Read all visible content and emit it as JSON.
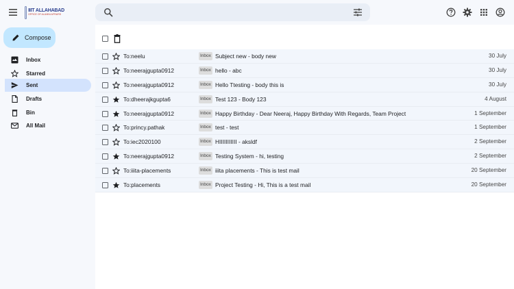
{
  "header": {
    "logo_title": "IIIT ALLAHABAD",
    "logo_subtitle": "OFFICE OF ALUMNI AFFAIRS",
    "search_placeholder": "",
    "search_value": ""
  },
  "sidebar": {
    "compose_label": "Compose",
    "items": [
      {
        "label": "Inbox",
        "icon": "inbox-icon",
        "active": false
      },
      {
        "label": "Starred",
        "icon": "star-icon",
        "active": false
      },
      {
        "label": "Sent",
        "icon": "send-icon",
        "active": true
      },
      {
        "label": "Drafts",
        "icon": "draft-icon",
        "active": false
      },
      {
        "label": "Bin",
        "icon": "bin-icon",
        "active": false
      },
      {
        "label": "All Mail",
        "icon": "mail-icon",
        "active": false
      }
    ]
  },
  "mails": [
    {
      "to": "To:neelu",
      "badge": "Inbox",
      "subject": "Subject new - body new",
      "date": "30 July",
      "starred": false
    },
    {
      "to": "To:neerajgupta0912",
      "badge": "Inbox",
      "subject": "hello - abc",
      "date": "30 July",
      "starred": false
    },
    {
      "to": "To:neerajgupta0912",
      "badge": "Inbox",
      "subject": "Hello Ttesting - body this is",
      "date": "30 July",
      "starred": false
    },
    {
      "to": "To:dheerajkgupta6",
      "badge": "Inbox",
      "subject": "Test 123 - Body 123",
      "date": "4 August",
      "starred": true
    },
    {
      "to": "To:neerajgupta0912",
      "badge": "Inbox",
      "subject": "Happy Birthday - Dear Neeraj, Happy Birthday With Regards, Team Project",
      "date": "1 September",
      "starred": true
    },
    {
      "to": "To:princy.pathak",
      "badge": "Inbox",
      "subject": "test - test",
      "date": "1 September",
      "starred": false
    },
    {
      "to": "To:iec2020100",
      "badge": "Inbox",
      "subject": "HIIIIIIIIIII - aksldf",
      "date": "2 September",
      "starred": false
    },
    {
      "to": "To:neerajgupta0912",
      "badge": "Inbox",
      "subject": "Testing System - hi, testing",
      "date": "2 September",
      "starred": true
    },
    {
      "to": "To:iiita-placements",
      "badge": "Inbox",
      "subject": "iiita placements - This is test mail",
      "date": "20 September",
      "starred": false
    },
    {
      "to": "To:placements",
      "badge": "Inbox",
      "subject": "Project Testing - Hi, This is a test mail",
      "date": "20 September",
      "starred": true
    }
  ],
  "colors": {
    "accent": "#c2e7ff",
    "active_nav": "#d3e3fd",
    "row_bg": "#f2f6fc",
    "page_bg": "#f6f8fc"
  }
}
